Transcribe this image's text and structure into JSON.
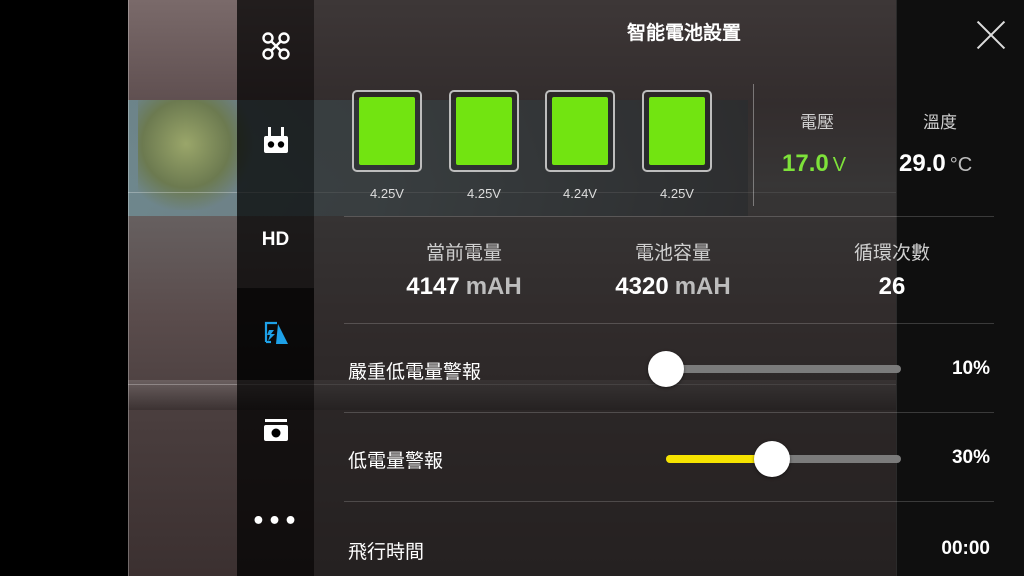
{
  "title": "智能電池設置",
  "cells": [
    {
      "voltage": "4.25V",
      "level": 1.0
    },
    {
      "voltage": "4.25V",
      "level": 1.0
    },
    {
      "voltage": "4.24V",
      "level": 1.0
    },
    {
      "voltage": "4.25V",
      "level": 1.0
    }
  ],
  "voltage": {
    "label": "電壓",
    "value": "17.0",
    "unit": "V",
    "color": "#7ee23a"
  },
  "temperature": {
    "label": "溫度",
    "value": "29.0",
    "unit": "°C"
  },
  "capacity": {
    "current": {
      "label": "當前電量",
      "value": "4147",
      "unit": "mAH"
    },
    "full": {
      "label": "電池容量",
      "value": "4320",
      "unit": "mAH"
    },
    "cycles": {
      "label": "循環次數",
      "value": "26"
    }
  },
  "critical_warning": {
    "label": "嚴重低電量警報",
    "value_text": "10%",
    "percent": 0
  },
  "low_warning": {
    "label": "低電量警報",
    "value_text": "30%",
    "percent": 45
  },
  "flight_time": {
    "label": "飛行時間",
    "value": "00:00"
  },
  "sidebar": {
    "items": [
      {
        "icon": "drone-icon"
      },
      {
        "icon": "remote-controller-icon"
      },
      {
        "label": "HD"
      },
      {
        "icon": "battery-settings-icon",
        "active": true
      },
      {
        "icon": "camera-icon"
      },
      {
        "label": "•••"
      }
    ]
  },
  "colors": {
    "accent": "#1ea1e8",
    "cell_fill": "#72e411",
    "slider_fill": "#f6e300"
  }
}
